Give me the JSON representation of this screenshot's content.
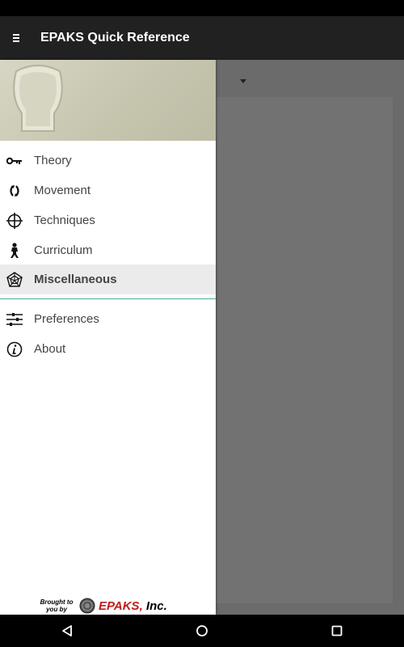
{
  "app_bar": {
    "title": "EPAKS Quick Reference",
    "menu_icon": "hamburger-icon"
  },
  "drawer": {
    "items": [
      {
        "label": "Theory",
        "icon": "key-icon"
      },
      {
        "label": "Movement",
        "icon": "movement-arrows-icon"
      },
      {
        "label": "Techniques",
        "icon": "crosshair-icon"
      },
      {
        "label": "Curriculum",
        "icon": "figure-icon"
      },
      {
        "label": "Miscellaneous",
        "icon": "web-icon",
        "active": true
      }
    ],
    "secondary_items": [
      {
        "label": "Preferences",
        "icon": "sliders-icon"
      },
      {
        "label": "About",
        "icon": "info-icon"
      }
    ],
    "footer": {
      "brought_by": "Brought to you by",
      "brand": "EPAKS,",
      "brand_suffix": " Inc."
    }
  },
  "colors": {
    "divider": "#4fa89b",
    "brand_red": "#c01c1c",
    "header": "#212121"
  },
  "system_nav": [
    "back-icon",
    "home-icon",
    "recents-icon"
  ]
}
